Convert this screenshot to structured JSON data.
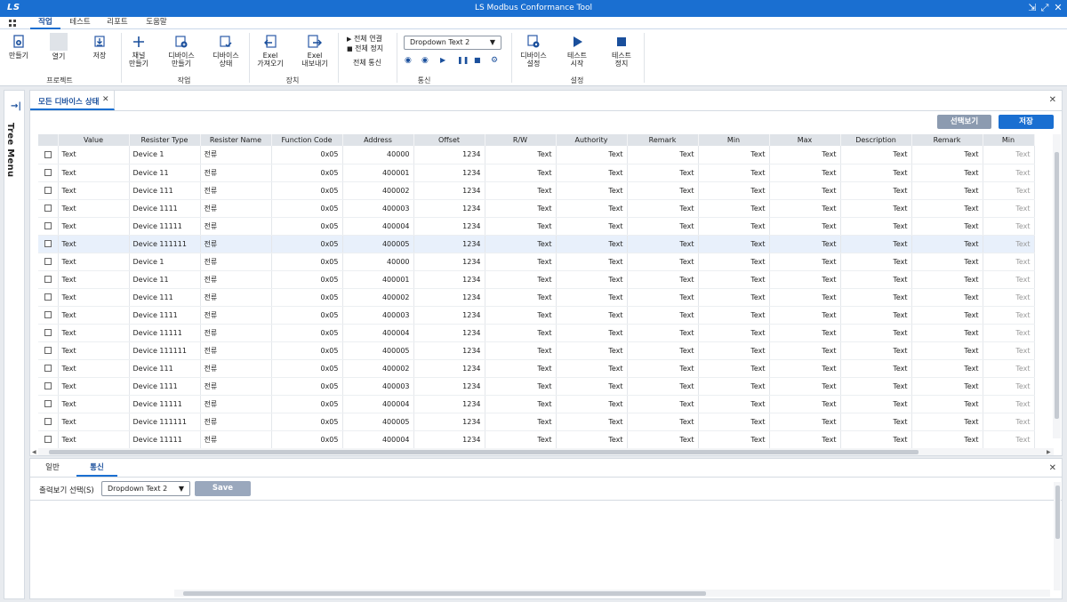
{
  "window": {
    "logo": "LS",
    "title": "LS Modbus Conformance Tool",
    "controls": [
      "⇲",
      "⤢",
      "✕"
    ]
  },
  "menu": {
    "tabs": [
      "작업",
      "테스트",
      "리포트",
      "도움말"
    ],
    "active": "작업"
  },
  "ribbon": {
    "project": {
      "new": "만들기",
      "open": "열기",
      "save": "저장",
      "group": "프로젝트"
    },
    "work": {
      "channel_line1": "채널",
      "channel_line2": "만들기",
      "device_make_line1": "디바이스",
      "device_make_line2": "만들기",
      "device_status_line1": "디바이스",
      "device_status_line2": "상태",
      "group": "작업"
    },
    "device": {
      "import_line1": "Exel",
      "import_line2": "가져오기",
      "export_line1": "Exel",
      "export_line2": "내보내기",
      "group": "장치"
    },
    "all_comm": {
      "connect_all": "전체 연결",
      "stop_all": "전체 정지",
      "group": "전체 통신"
    },
    "comm": {
      "dropdown_value": "Dropdown Text 2",
      "group": "통신"
    },
    "settings": {
      "device_settings_line1": "디바이스",
      "device_settings_line2": "설정",
      "test_start_line1": "테스트",
      "test_start_line2": "시작",
      "test_stop_line1": "테스트",
      "test_stop_line2": "정지",
      "group": "설정"
    }
  },
  "tree": {
    "label": "Tree Menu"
  },
  "main": {
    "tab_label": "모든 디바이스 상태",
    "btn_select_view": "선택보기",
    "btn_save": "저장",
    "columns": [
      "",
      "Value",
      "Resister Type",
      "Resister Name",
      "Function Code",
      "Address",
      "Offset",
      "R/W",
      "Authority",
      "Remark",
      "Min",
      "Max",
      "Description",
      "Remark",
      "Min"
    ],
    "rows": [
      [
        "Text",
        "Device 1",
        "전류",
        "0x05",
        "40000",
        "1234",
        "Text",
        "Text",
        "Text",
        "Text",
        "Text",
        "Text",
        "Text",
        "Text"
      ],
      [
        "Text",
        "Device 11",
        "전류",
        "0x05",
        "400001",
        "1234",
        "Text",
        "Text",
        "Text",
        "Text",
        "Text",
        "Text",
        "Text",
        "Text"
      ],
      [
        "Text",
        "Device 111",
        "전류",
        "0x05",
        "400002",
        "1234",
        "Text",
        "Text",
        "Text",
        "Text",
        "Text",
        "Text",
        "Text",
        "Text"
      ],
      [
        "Text",
        "Device 1111",
        "전류",
        "0x05",
        "400003",
        "1234",
        "Text",
        "Text",
        "Text",
        "Text",
        "Text",
        "Text",
        "Text",
        "Text"
      ],
      [
        "Text",
        "Device 11111",
        "전류",
        "0x05",
        "400004",
        "1234",
        "Text",
        "Text",
        "Text",
        "Text",
        "Text",
        "Text",
        "Text",
        "Text"
      ],
      [
        "Text",
        "Device 111111",
        "전류",
        "0x05",
        "400005",
        "1234",
        "Text",
        "Text",
        "Text",
        "Text",
        "Text",
        "Text",
        "Text",
        "Text"
      ],
      [
        "Text",
        "Device 1",
        "전류",
        "0x05",
        "40000",
        "1234",
        "Text",
        "Text",
        "Text",
        "Text",
        "Text",
        "Text",
        "Text",
        "Text"
      ],
      [
        "Text",
        "Device 11",
        "전류",
        "0x05",
        "400001",
        "1234",
        "Text",
        "Text",
        "Text",
        "Text",
        "Text",
        "Text",
        "Text",
        "Text"
      ],
      [
        "Text",
        "Device 111",
        "전류",
        "0x05",
        "400002",
        "1234",
        "Text",
        "Text",
        "Text",
        "Text",
        "Text",
        "Text",
        "Text",
        "Text"
      ],
      [
        "Text",
        "Device 1111",
        "전류",
        "0x05",
        "400003",
        "1234",
        "Text",
        "Text",
        "Text",
        "Text",
        "Text",
        "Text",
        "Text",
        "Text"
      ],
      [
        "Text",
        "Device 11111",
        "전류",
        "0x05",
        "400004",
        "1234",
        "Text",
        "Text",
        "Text",
        "Text",
        "Text",
        "Text",
        "Text",
        "Text"
      ],
      [
        "Text",
        "Device 111111",
        "전류",
        "0x05",
        "400005",
        "1234",
        "Text",
        "Text",
        "Text",
        "Text",
        "Text",
        "Text",
        "Text",
        "Text"
      ],
      [
        "Text",
        "Device 111",
        "전류",
        "0x05",
        "400002",
        "1234",
        "Text",
        "Text",
        "Text",
        "Text",
        "Text",
        "Text",
        "Text",
        "Text"
      ],
      [
        "Text",
        "Device 1111",
        "전류",
        "0x05",
        "400003",
        "1234",
        "Text",
        "Text",
        "Text",
        "Text",
        "Text",
        "Text",
        "Text",
        "Text"
      ],
      [
        "Text",
        "Device 11111",
        "전류",
        "0x05",
        "400004",
        "1234",
        "Text",
        "Text",
        "Text",
        "Text",
        "Text",
        "Text",
        "Text",
        "Text"
      ],
      [
        "Text",
        "Device 111111",
        "전류",
        "0x05",
        "400005",
        "1234",
        "Text",
        "Text",
        "Text",
        "Text",
        "Text",
        "Text",
        "Text",
        "Text"
      ],
      [
        "Text",
        "Device 11111",
        "전류",
        "0x05",
        "400004",
        "1234",
        "Text",
        "Text",
        "Text",
        "Text",
        "Text",
        "Text",
        "Text",
        "Text"
      ]
    ],
    "selected_row": 5
  },
  "bottom": {
    "tabs": [
      "일반",
      "통신"
    ],
    "active": "통신",
    "output_label": "출력보기 선택(S)",
    "output_dropdown": "Dropdown Text 2",
    "save_label": "Save"
  },
  "colors": {
    "accent": "#1a6fd1",
    "header_bg": "#dfe3e8",
    "selected_row": "#e8f0fb"
  }
}
